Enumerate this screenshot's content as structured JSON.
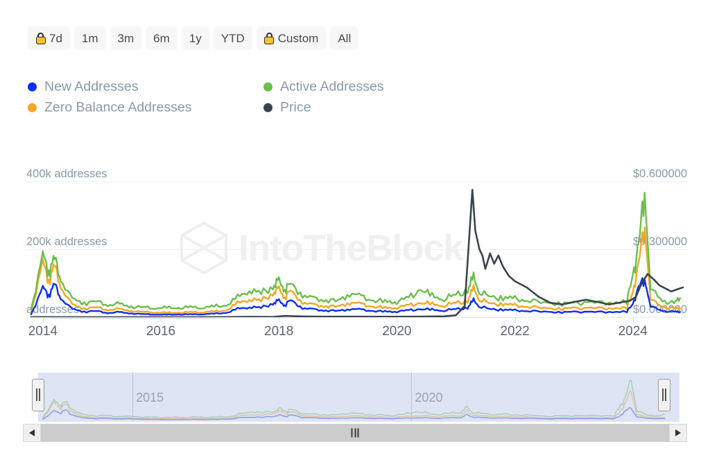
{
  "range_selector": {
    "buttons": [
      {
        "label": "7d",
        "locked": true,
        "selected": false
      },
      {
        "label": "1m",
        "locked": false,
        "selected": false
      },
      {
        "label": "3m",
        "locked": false,
        "selected": false
      },
      {
        "label": "6m",
        "locked": false,
        "selected": false
      },
      {
        "label": "1y",
        "locked": false,
        "selected": false
      },
      {
        "label": "YTD",
        "locked": false,
        "selected": false
      },
      {
        "label": "Custom",
        "locked": true,
        "selected": false
      },
      {
        "label": "All",
        "locked": false,
        "selected": true
      }
    ],
    "lock_icon": "lock-icon"
  },
  "legend": {
    "items": [
      {
        "label": "New Addresses",
        "color": "#0b2ff5"
      },
      {
        "label": "Active Addresses",
        "color": "#6bbf4b"
      },
      {
        "label": "Zero Balance Addresses",
        "color": "#f5a623"
      },
      {
        "label": "Price",
        "color": "#3c434c"
      }
    ]
  },
  "watermark": {
    "text": "IntoTheBlock",
    "logo": "hexagon-logo-icon"
  },
  "navigator": {
    "year_labels": [
      {
        "text": "2015",
        "x_pct": 16.5
      },
      {
        "text": "2020",
        "x_pct": 58.5
      }
    ],
    "left_handle_pct": 2.3,
    "right_handle_pct": 96.6
  },
  "scrollbar": {
    "left_arrow": "triangle-left-icon",
    "right_arrow": "triangle-right-icon",
    "grip": "grip-icon"
  },
  "chart_data": {
    "type": "line",
    "title": "",
    "xlabel": "",
    "ylabel_left": "addresses",
    "ylabel_right": "price",
    "grid": true,
    "legend_position": "top-left",
    "x_ticks": [
      "2014",
      "2016",
      "2018",
      "2020",
      "2022",
      "2024"
    ],
    "x_range": [
      "2013-08",
      "2024-10"
    ],
    "left_axis": {
      "ticks": [
        "addresses",
        "200k addresses",
        "400k addresses"
      ],
      "tick_values": [
        0,
        200000,
        400000
      ],
      "ylim": [
        0,
        440000
      ],
      "unit": "addresses"
    },
    "right_axis": {
      "ticks": [
        "$0.000000",
        "$0.300000",
        "$0.600000"
      ],
      "tick_values": [
        0,
        0.3,
        0.6
      ],
      "ylim": [
        0,
        0.66
      ],
      "unit": "USD"
    },
    "series": [
      {
        "name": "New Addresses",
        "color": "#0b2ff5",
        "axis": "left",
        "x": [
          "2013.8",
          "2014.0",
          "2014.1",
          "2014.2",
          "2014.3",
          "2014.5",
          "2014.7",
          "2014.9",
          "2015.1",
          "2015.3",
          "2015.5",
          "2015.7",
          "2015.9",
          "2016.1",
          "2016.3",
          "2016.5",
          "2016.7",
          "2016.9",
          "2017.1",
          "2017.3",
          "2017.5",
          "2017.7",
          "2017.9",
          "2018.0",
          "2018.1",
          "2018.2",
          "2018.4",
          "2018.6",
          "2018.8",
          "2019.0",
          "2019.2",
          "2019.4",
          "2019.6",
          "2019.8",
          "2020.0",
          "2020.2",
          "2020.4",
          "2020.6",
          "2020.8",
          "2021.0",
          "2021.2",
          "2021.3",
          "2021.4",
          "2021.6",
          "2021.8",
          "2022.0",
          "2022.2",
          "2022.5",
          "2022.8",
          "2023.0",
          "2023.3",
          "2023.6",
          "2023.9",
          "2024.0",
          "2024.1",
          "2024.2",
          "2024.3",
          "2024.5",
          "2024.7",
          "2024.8"
        ],
        "values": [
          9000,
          95000,
          72000,
          110000,
          60000,
          26000,
          18000,
          20000,
          14000,
          16000,
          12000,
          10000,
          9000,
          8000,
          9000,
          9000,
          10000,
          11000,
          14000,
          26000,
          34000,
          30000,
          45000,
          52000,
          40000,
          55000,
          30000,
          24000,
          22000,
          20000,
          27000,
          24000,
          20000,
          18000,
          19000,
          22000,
          26000,
          24000,
          22000,
          26000,
          30000,
          56000,
          34000,
          26000,
          24000,
          22000,
          20000,
          18000,
          16000,
          17000,
          18000,
          16000,
          20000,
          40000,
          100000,
          120000,
          36000,
          20000,
          18000,
          17000
        ]
      },
      {
        "name": "Active Addresses",
        "color": "#6bbf4b",
        "axis": "left",
        "x": [
          "2013.8",
          "2014.0",
          "2014.1",
          "2014.2",
          "2014.3",
          "2014.5",
          "2014.7",
          "2014.9",
          "2015.1",
          "2015.3",
          "2015.5",
          "2015.7",
          "2015.9",
          "2016.1",
          "2016.3",
          "2016.5",
          "2016.7",
          "2016.9",
          "2017.1",
          "2017.3",
          "2017.5",
          "2017.7",
          "2017.9",
          "2018.0",
          "2018.1",
          "2018.2",
          "2018.4",
          "2018.6",
          "2018.8",
          "2019.0",
          "2019.2",
          "2019.4",
          "2019.6",
          "2019.8",
          "2020.0",
          "2020.2",
          "2020.4",
          "2020.6",
          "2020.8",
          "2021.0",
          "2021.2",
          "2021.3",
          "2021.4",
          "2021.6",
          "2021.8",
          "2022.0",
          "2022.2",
          "2022.5",
          "2022.8",
          "2023.0",
          "2023.3",
          "2023.6",
          "2023.9",
          "2024.0",
          "2024.1",
          "2024.2",
          "2024.3",
          "2024.5",
          "2024.7",
          "2024.8"
        ],
        "values": [
          25000,
          200000,
          150000,
          195000,
          120000,
          58000,
          46000,
          52000,
          40000,
          42000,
          34000,
          32000,
          30000,
          30000,
          30000,
          32000,
          32000,
          34000,
          38000,
          62000,
          90000,
          76000,
          100000,
          115000,
          92000,
          108000,
          72000,
          58000,
          56000,
          52000,
          78000,
          66000,
          54000,
          50000,
          52000,
          62000,
          90000,
          68000,
          60000,
          72000,
          86000,
          132000,
          80000,
          66000,
          62000,
          60000,
          54000,
          48000,
          44000,
          46000,
          50000,
          44000,
          56000,
          130000,
          240000,
          400000,
          96000,
          52000,
          46000,
          62000
        ]
      },
      {
        "name": "Zero Balance Addresses",
        "color": "#f5a623",
        "axis": "left",
        "x": [
          "2013.8",
          "2014.0",
          "2014.1",
          "2014.2",
          "2014.3",
          "2014.5",
          "2014.7",
          "2014.9",
          "2015.1",
          "2015.3",
          "2015.5",
          "2015.7",
          "2015.9",
          "2016.1",
          "2016.3",
          "2016.5",
          "2016.7",
          "2016.9",
          "2017.1",
          "2017.3",
          "2017.5",
          "2017.7",
          "2017.9",
          "2018.0",
          "2018.1",
          "2018.2",
          "2018.4",
          "2018.6",
          "2018.8",
          "2019.0",
          "2019.2",
          "2019.4",
          "2019.6",
          "2019.8",
          "2020.0",
          "2020.2",
          "2020.4",
          "2020.6",
          "2020.8",
          "2021.0",
          "2021.2",
          "2021.3",
          "2021.4",
          "2021.6",
          "2021.8",
          "2022.0",
          "2022.2",
          "2022.5",
          "2022.8",
          "2023.0",
          "2023.3",
          "2023.6",
          "2023.9",
          "2024.0",
          "2024.1",
          "2024.2",
          "2024.3",
          "2024.5",
          "2024.7",
          "2024.8"
        ],
        "values": [
          16000,
          178000,
          120000,
          170000,
          96000,
          40000,
          28000,
          32000,
          24000,
          26000,
          20000,
          17000,
          16000,
          14000,
          15000,
          16000,
          17000,
          18000,
          22000,
          44000,
          60000,
          52000,
          78000,
          90000,
          66000,
          86000,
          48000,
          38000,
          36000,
          34000,
          48000,
          42000,
          34000,
          30000,
          32000,
          38000,
          46000,
          42000,
          38000,
          46000,
          52000,
          96000,
          56000,
          44000,
          42000,
          38000,
          34000,
          30000,
          27000,
          29000,
          31000,
          27000,
          34000,
          76000,
          180000,
          290000,
          60000,
          32000,
          29000,
          28000
        ]
      },
      {
        "name": "Price",
        "color": "#3c434c",
        "axis": "right",
        "x": [
          "2013.8",
          "2014.0",
          "2014.3",
          "2014.7",
          "2015.1",
          "2015.5",
          "2015.9",
          "2016.3",
          "2016.7",
          "2017.1",
          "2017.5",
          "2017.9",
          "2018.1",
          "2018.4",
          "2018.8",
          "2019.2",
          "2019.6",
          "2020.0",
          "2020.4",
          "2020.8",
          "2021.0",
          "2021.15",
          "2021.28",
          "2021.33",
          "2021.4",
          "2021.45",
          "2021.5",
          "2021.58",
          "2021.65",
          "2021.72",
          "2021.8",
          "2021.9",
          "2022.0",
          "2022.2",
          "2022.4",
          "2022.6",
          "2022.8",
          "2023.0",
          "2023.2",
          "2023.4",
          "2023.6",
          "2023.8",
          "2023.95",
          "2024.05",
          "2024.15",
          "2024.25",
          "2024.35",
          "2024.45",
          "2024.55",
          "2024.65",
          "2024.75",
          "2024.85"
        ],
        "values": [
          0.0004,
          0.0006,
          0.0003,
          0.0002,
          0.0002,
          0.0001,
          0.0001,
          0.0001,
          0.0002,
          0.0005,
          0.0018,
          0.0012,
          0.006,
          0.0035,
          0.0024,
          0.0028,
          0.0024,
          0.0022,
          0.0028,
          0.004,
          0.009,
          0.055,
          0.62,
          0.42,
          0.33,
          0.3,
          0.235,
          0.31,
          0.26,
          0.3,
          0.245,
          0.2,
          0.175,
          0.145,
          0.1,
          0.07,
          0.062,
          0.073,
          0.085,
          0.074,
          0.062,
          0.072,
          0.08,
          0.098,
          0.165,
          0.21,
          0.185,
          0.155,
          0.14,
          0.125,
          0.135,
          0.145
        ]
      }
    ]
  }
}
